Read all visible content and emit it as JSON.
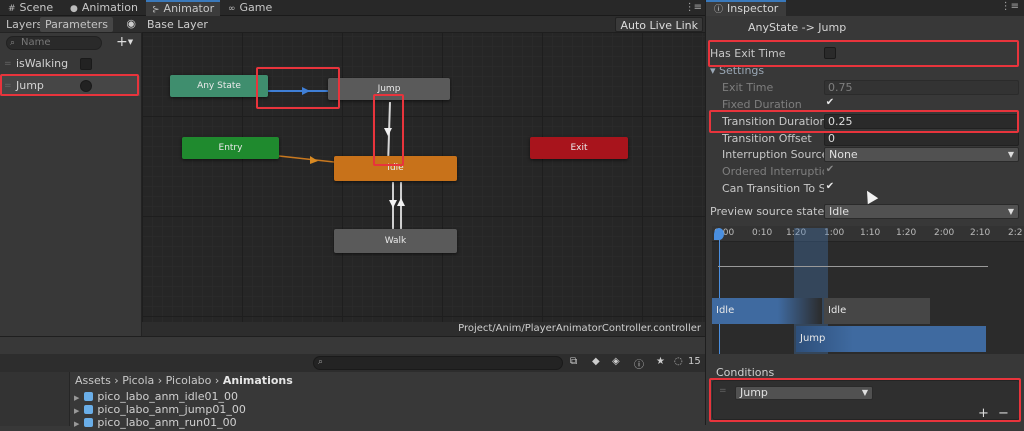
{
  "tabs": [
    {
      "label": "Scene",
      "icon": "grid-icon"
    },
    {
      "label": "Animation",
      "icon": "clock-icon"
    },
    {
      "label": "Animator",
      "icon": "animator-icon"
    },
    {
      "label": "Game",
      "icon": "gamepad-icon"
    }
  ],
  "left_panel": {
    "tabs": [
      "Layers",
      "Parameters"
    ],
    "search_placeholder": "Name",
    "add_label": "+",
    "parameters": [
      {
        "name": "isWalking",
        "type": "bool"
      },
      {
        "name": "Jump",
        "type": "trigger"
      }
    ]
  },
  "graph": {
    "breadcrumb": "Base Layer",
    "auto_live_link": "Auto Live Link",
    "nodes": {
      "any_state": "Any State",
      "jump": "Jump",
      "entry": "Entry",
      "idle": "Idle",
      "exit": "Exit",
      "walk": "Walk"
    },
    "path": "Project/Anim/PlayerAnimatorController.controller"
  },
  "bottom": {
    "count": "15",
    "breadcrumb": [
      "Assets",
      "Picola",
      "Picolabo",
      "Animations"
    ],
    "files": [
      "pico_labo_anm_idle01_00",
      "pico_labo_anm_jump01_00",
      "pico_labo_anm_run01_00"
    ]
  },
  "inspector": {
    "tab": "Inspector",
    "title": "AnyState -> Jump",
    "has_exit_time": {
      "label": "Has Exit Time",
      "checked": false
    },
    "settings_label": "Settings",
    "exit_time": {
      "label": "Exit Time",
      "value": "0.75"
    },
    "fixed_duration": {
      "label": "Fixed Duration",
      "value": "✔"
    },
    "transition_duration": {
      "label": "Transition Duration (s)",
      "value": "0.25"
    },
    "transition_offset": {
      "label": "Transition Offset",
      "value": "0"
    },
    "interruption_source": {
      "label": "Interruption Source",
      "value": "None"
    },
    "ordered_interruption": {
      "label": "Ordered Interruption",
      "value": "✔"
    },
    "can_transition_to_self": {
      "label": "Can Transition To Self",
      "value": "✔"
    },
    "preview_source_state": {
      "label": "Preview source state",
      "value": "Idle"
    },
    "timeline": {
      "ticks": [
        "0:00",
        "0:10",
        "1:20",
        "1:00",
        "1:10",
        "1:20",
        "2:00",
        "2:10",
        "2:2"
      ],
      "bars": [
        "Idle",
        "Idle",
        "Jump"
      ]
    },
    "conditions": {
      "label": "Conditions",
      "parameter": "Jump",
      "add": "+",
      "remove": "−"
    }
  }
}
